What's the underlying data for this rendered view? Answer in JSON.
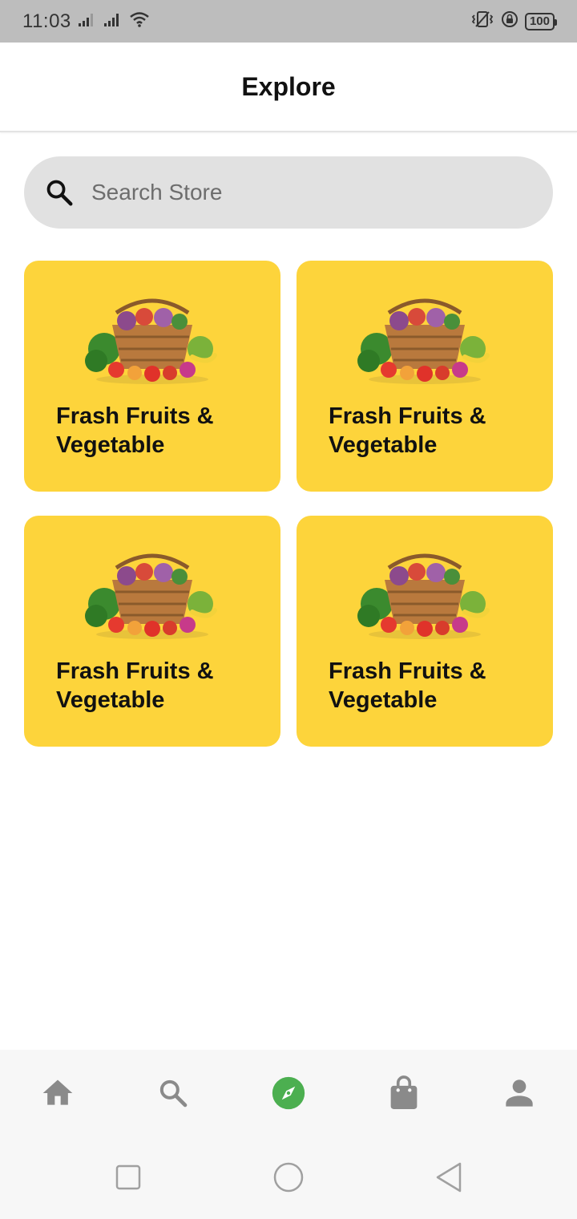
{
  "status_bar": {
    "time": "11:03",
    "battery": "100",
    "icons": [
      "signal-icon",
      "signal-icon",
      "wifi-icon",
      "vibrate-icon",
      "lock-rotation-icon",
      "battery-icon"
    ]
  },
  "app_bar": {
    "title": "Explore"
  },
  "search": {
    "placeholder": "Search Store",
    "icon": "search-icon"
  },
  "categories": [
    {
      "label": "Frash Fruits & Vegetable",
      "icon": "vegetable-basket-image"
    },
    {
      "label": "Frash Fruits & Vegetable",
      "icon": "vegetable-basket-image"
    },
    {
      "label": "Frash Fruits & Vegetable",
      "icon": "vegetable-basket-image"
    },
    {
      "label": "Frash Fruits & Vegetable",
      "icon": "vegetable-basket-image"
    }
  ],
  "bottom_nav": {
    "items": [
      {
        "name": "home",
        "icon": "home-icon",
        "active": false
      },
      {
        "name": "search",
        "icon": "search-icon",
        "active": false
      },
      {
        "name": "explore",
        "icon": "compass-icon",
        "active": true
      },
      {
        "name": "cart",
        "icon": "shopping-bag-icon",
        "active": false
      },
      {
        "name": "profile",
        "icon": "person-icon",
        "active": false
      }
    ],
    "active_color": "#4caf50",
    "inactive_color": "#8a8a8a"
  },
  "system_nav": {
    "buttons": [
      "recents-icon",
      "home-circle-icon",
      "back-triangle-icon"
    ]
  },
  "colors": {
    "card": "#fdd43b",
    "search_bg": "#e1e1e1",
    "status_bar": "#bdbdbd"
  }
}
